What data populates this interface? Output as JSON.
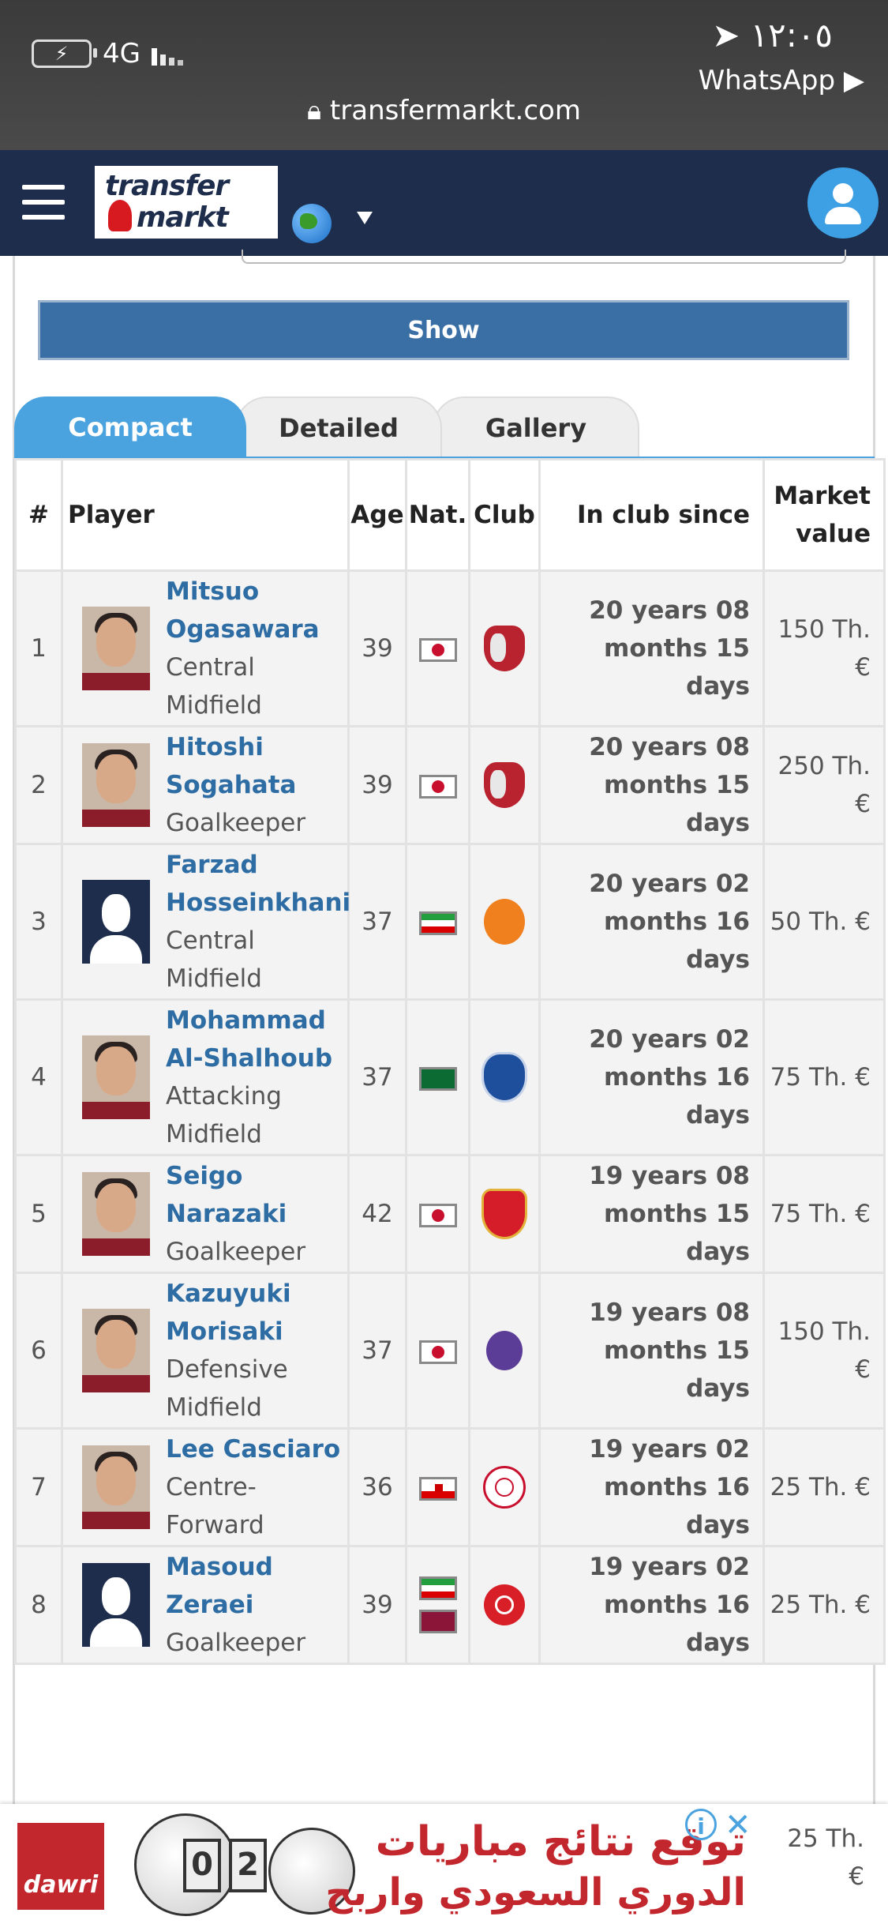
{
  "status_bar": {
    "network": "4G",
    "time": "١٢:٠٥",
    "back_app": "WhatsApp ▶",
    "url": "transfermarkt.com"
  },
  "header": {
    "logo_line1": "transfer",
    "logo_line2": "markt"
  },
  "search": {
    "show_button": "Show"
  },
  "tabs": [
    "Compact",
    "Detailed",
    "Gallery"
  ],
  "table": {
    "columns": [
      "#",
      "Player",
      "Age",
      "Nat.",
      "Club",
      "In club since",
      "Market value"
    ],
    "rows": [
      {
        "num": "1",
        "name": "Mitsuo Ogasawara",
        "position": "Central Midfield",
        "age": "39",
        "nat": [
          "jp"
        ],
        "club": "kash",
        "since": "20 years 08 months 15 days",
        "value": "150 Th. €",
        "photo": "player"
      },
      {
        "num": "2",
        "name": "Hitoshi Sogahata",
        "position": "Goalkeeper",
        "age": "39",
        "nat": [
          "jp"
        ],
        "club": "kash",
        "since": "20 years 08 months 15 days",
        "value": "250 Th. €",
        "photo": "player"
      },
      {
        "num": "3",
        "name": "Farzad Hosseinkhani",
        "position": "Central Midfield",
        "age": "37",
        "nat": [
          "ir"
        ],
        "club": "saipa",
        "since": "20 years 02 months 16 days",
        "value": "50 Th. €",
        "photo": "silhouette"
      },
      {
        "num": "4",
        "name": "Mohammad Al-Shalhoub",
        "position": "Attacking Midfield",
        "age": "37",
        "nat": [
          "sa"
        ],
        "club": "hilal",
        "since": "20 years 02 months 16 days",
        "value": "75 Th. €",
        "photo": "player"
      },
      {
        "num": "5",
        "name": "Seigo Narazaki",
        "position": "Goalkeeper",
        "age": "42",
        "nat": [
          "jp"
        ],
        "club": "nagoya",
        "since": "19 years 08 months 15 days",
        "value": "75 Th. €",
        "photo": "player"
      },
      {
        "num": "6",
        "name": "Kazuyuki Morisaki",
        "position": "Defensive Midfield",
        "age": "37",
        "nat": [
          "jp"
        ],
        "club": "hiro",
        "since": "19 years 08 months 15 days",
        "value": "150 Th. €",
        "photo": "player"
      },
      {
        "num": "7",
        "name": "Lee Casciaro",
        "position": "Centre-Forward",
        "age": "36",
        "nat": [
          "gi"
        ],
        "club": "gib",
        "since": "19 years 02 months 16 days",
        "value": "25 Th. €",
        "photo": "player"
      },
      {
        "num": "8",
        "name": "Masoud Zeraei",
        "position": "Goalkeeper",
        "age": "39",
        "nat": [
          "ir",
          "qa"
        ],
        "club": "pers",
        "since": "19 years 02 months 16 days",
        "value": "25 Th. €",
        "photo": "silhouette"
      }
    ],
    "partial_row_value": "25 Th. €"
  },
  "ad": {
    "brand": "dawri",
    "score": [
      "0",
      "2"
    ],
    "line1": "توقع نتائج مباريات",
    "line2": "الدوري السعودي واربح"
  }
}
